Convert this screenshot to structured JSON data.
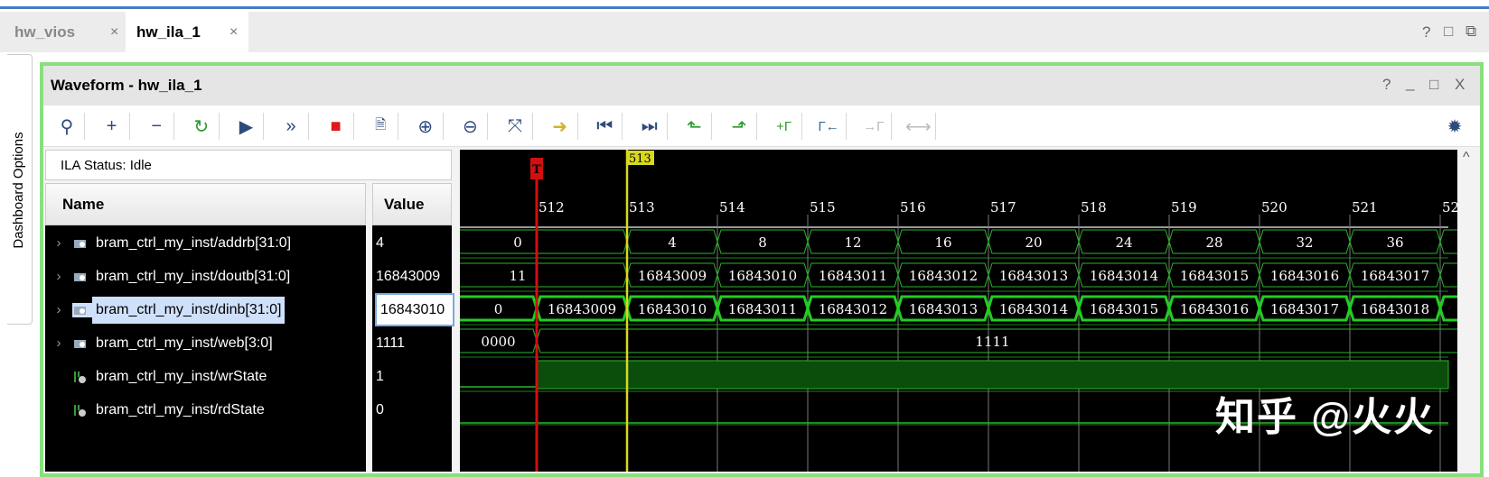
{
  "tabs": [
    {
      "label": "hw_vios",
      "active": false
    },
    {
      "label": "hw_ila_1",
      "active": true
    }
  ],
  "tab_close": "×",
  "window_controls": [
    "?",
    "□",
    "⧉"
  ],
  "dashboard_label": "Dashboard Options",
  "panel": {
    "title": "Waveform - hw_ila_1",
    "controls": [
      "?",
      "_",
      "□",
      "X"
    ]
  },
  "toolbar": [
    "search",
    "add",
    "remove",
    "run-trigger-immediate",
    "run-trigger",
    "auto-rerun",
    "stop",
    "export",
    "zoom-in",
    "zoom-out",
    "zoom-fit",
    "go-to-cursor",
    "go-to-time-0",
    "go-to-last-time",
    "previous-transition",
    "next-transition",
    "add-marker",
    "previous-marker",
    "next-marker",
    "swap-cursors"
  ],
  "ila_status": "ILA Status:  Idle",
  "columns": {
    "name": "Name",
    "value": "Value"
  },
  "signals": [
    {
      "name": "bram_ctrl_my_inst/addrb[31:0]",
      "value": "4",
      "type": "bus",
      "expandable": true
    },
    {
      "name": "bram_ctrl_my_inst/doutb[31:0]",
      "value": "16843009",
      "type": "bus",
      "expandable": true
    },
    {
      "name": "bram_ctrl_my_inst/dinb[31:0]",
      "value": "16843010",
      "type": "bus",
      "expandable": true,
      "selected": true
    },
    {
      "name": "bram_ctrl_my_inst/web[3:0]",
      "value": "1111",
      "type": "bus",
      "expandable": true
    },
    {
      "name": "bram_ctrl_my_inst/wrState",
      "value": "1",
      "type": "bit"
    },
    {
      "name": "bram_ctrl_my_inst/rdState",
      "value": "0",
      "type": "bit"
    }
  ],
  "waveform": {
    "ticks": [
      "512",
      "513",
      "514",
      "515",
      "516",
      "517",
      "518",
      "519",
      "520",
      "521",
      "52"
    ],
    "trigger_marker": {
      "label": "T",
      "time": 512,
      "color": "#d01010"
    },
    "cursor": {
      "label": "513",
      "time": 513,
      "color": "#d8d820"
    },
    "traces": [
      {
        "segments": [
          {
            "t": null,
            "v": "0"
          },
          {
            "t": 513,
            "v": "4"
          },
          {
            "t": 514,
            "v": "8"
          },
          {
            "t": 515,
            "v": "12"
          },
          {
            "t": 516,
            "v": "16"
          },
          {
            "t": 517,
            "v": "20"
          },
          {
            "t": 518,
            "v": "24"
          },
          {
            "t": 519,
            "v": "28"
          },
          {
            "t": 520,
            "v": "32"
          },
          {
            "t": 521,
            "v": "36"
          },
          {
            "t": 522,
            "v": ""
          }
        ]
      },
      {
        "segments": [
          {
            "t": null,
            "v": "11"
          },
          {
            "t": 513,
            "v": "16843009"
          },
          {
            "t": 514,
            "v": "16843010"
          },
          {
            "t": 515,
            "v": "16843011"
          },
          {
            "t": 516,
            "v": "16843012"
          },
          {
            "t": 517,
            "v": "16843013"
          },
          {
            "t": 518,
            "v": "16843014"
          },
          {
            "t": 519,
            "v": "16843015"
          },
          {
            "t": 520,
            "v": "16843016"
          },
          {
            "t": 521,
            "v": "16843017"
          },
          {
            "t": 522,
            "v": ""
          }
        ]
      },
      {
        "thick": true,
        "segments": [
          {
            "t": null,
            "v": "0"
          },
          {
            "t": 512,
            "v": "16843009"
          },
          {
            "t": 513,
            "v": "16843010"
          },
          {
            "t": 514,
            "v": "16843011"
          },
          {
            "t": 515,
            "v": "16843012"
          },
          {
            "t": 516,
            "v": "16843013"
          },
          {
            "t": 517,
            "v": "16843014"
          },
          {
            "t": 518,
            "v": "16843015"
          },
          {
            "t": 519,
            "v": "16843016"
          },
          {
            "t": 520,
            "v": "16843017"
          },
          {
            "t": 521,
            "v": "16843018"
          },
          {
            "t": 522,
            "v": ""
          }
        ]
      },
      {
        "segments": [
          {
            "t": null,
            "v": "0000"
          },
          {
            "t": 512,
            "v": "1111"
          }
        ]
      },
      {
        "bit": true,
        "high_from": 512
      },
      {
        "bit": true,
        "high_from": null
      }
    ]
  },
  "watermark": "知乎 @火火",
  "colors": {
    "accent_green": "#88e07c",
    "wave_green": "#2bb52b",
    "tab_blue": "#4a7bc4"
  }
}
